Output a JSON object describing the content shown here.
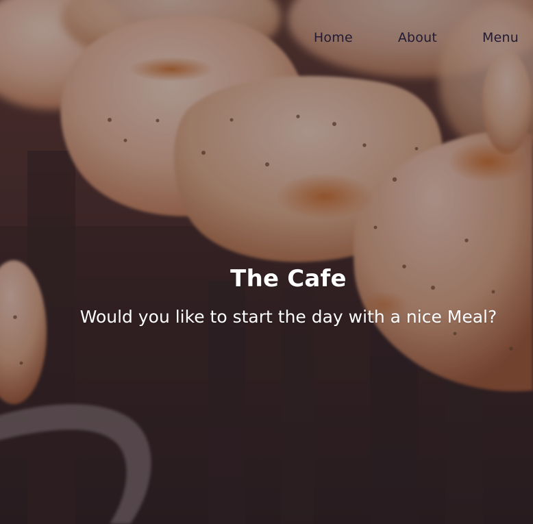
{
  "nav": {
    "items": [
      {
        "label": "Home"
      },
      {
        "label": "About"
      },
      {
        "label": "Menu"
      }
    ]
  },
  "hero": {
    "title": "The Cafe",
    "subtitle": "Would you like to start the day with a nice Meal?"
  }
}
